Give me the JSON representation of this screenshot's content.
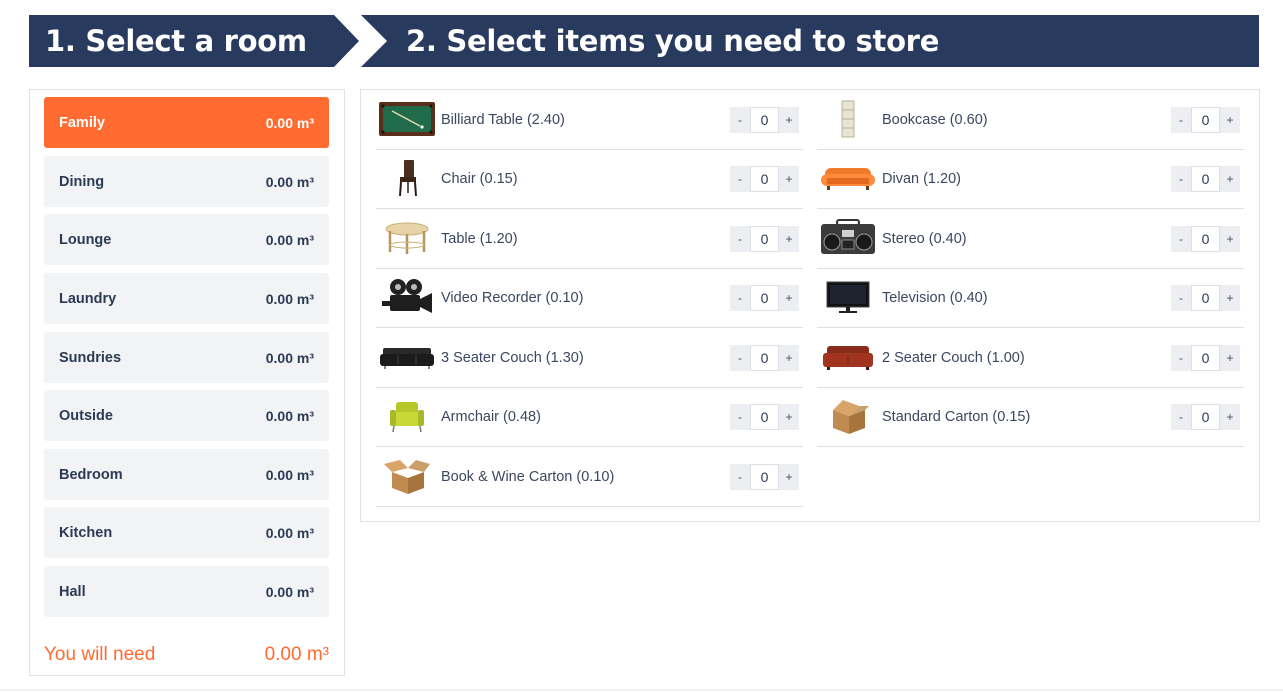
{
  "header": {
    "step1": "1. Select a room",
    "step2": "2. Select items you need to store"
  },
  "colors": {
    "accent": "#ff6b30",
    "navy": "#283a5e",
    "tile": "#f2f3f5"
  },
  "rooms": [
    {
      "label": "Family",
      "total": "0.00 m³",
      "active": true
    },
    {
      "label": "Dining",
      "total": "0.00 m³"
    },
    {
      "label": "Lounge",
      "total": "0.00 m³"
    },
    {
      "label": "Laundry",
      "total": "0.00 m³"
    },
    {
      "label": "Sundries",
      "total": "0.00 m³"
    },
    {
      "label": "Outside",
      "total": "0.00 m³"
    },
    {
      "label": "Bedroom",
      "total": "0.00 m³"
    },
    {
      "label": "Kitchen",
      "total": "0.00 m³"
    },
    {
      "label": "Hall",
      "total": "0.00 m³"
    }
  ],
  "summary": {
    "label": "You will need",
    "total": "0.00 m³"
  },
  "items": [
    {
      "label": "Billiard Table (2.40)",
      "qty": "0",
      "icon": "billiard-table-icon"
    },
    {
      "label": "Bookcase (0.60)",
      "qty": "0",
      "icon": "bookcase-icon"
    },
    {
      "label": "Chair (0.15)",
      "qty": "0",
      "icon": "chair-icon"
    },
    {
      "label": "Divan (1.20)",
      "qty": "0",
      "icon": "divan-icon"
    },
    {
      "label": "Table (1.20)",
      "qty": "0",
      "icon": "table-icon"
    },
    {
      "label": "Stereo (0.40)",
      "qty": "0",
      "icon": "stereo-icon"
    },
    {
      "label": "Video Recorder (0.10)",
      "qty": "0",
      "icon": "video-camera-icon"
    },
    {
      "label": "Television (0.40)",
      "qty": "0",
      "icon": "television-icon"
    },
    {
      "label": "3 Seater Couch (1.30)",
      "qty": "0",
      "icon": "three-seater-couch-icon"
    },
    {
      "label": "2 Seater Couch (1.00)",
      "qty": "0",
      "icon": "two-seater-couch-icon"
    },
    {
      "label": "Armchair (0.48)",
      "qty": "0",
      "icon": "armchair-icon"
    },
    {
      "label": "Standard Carton (0.15)",
      "qty": "0",
      "icon": "carton-icon"
    },
    {
      "label": "Book & Wine Carton (0.10)",
      "qty": "0",
      "icon": "carton-icon"
    }
  ],
  "stepper": {
    "minus": "-",
    "plus": "+"
  }
}
